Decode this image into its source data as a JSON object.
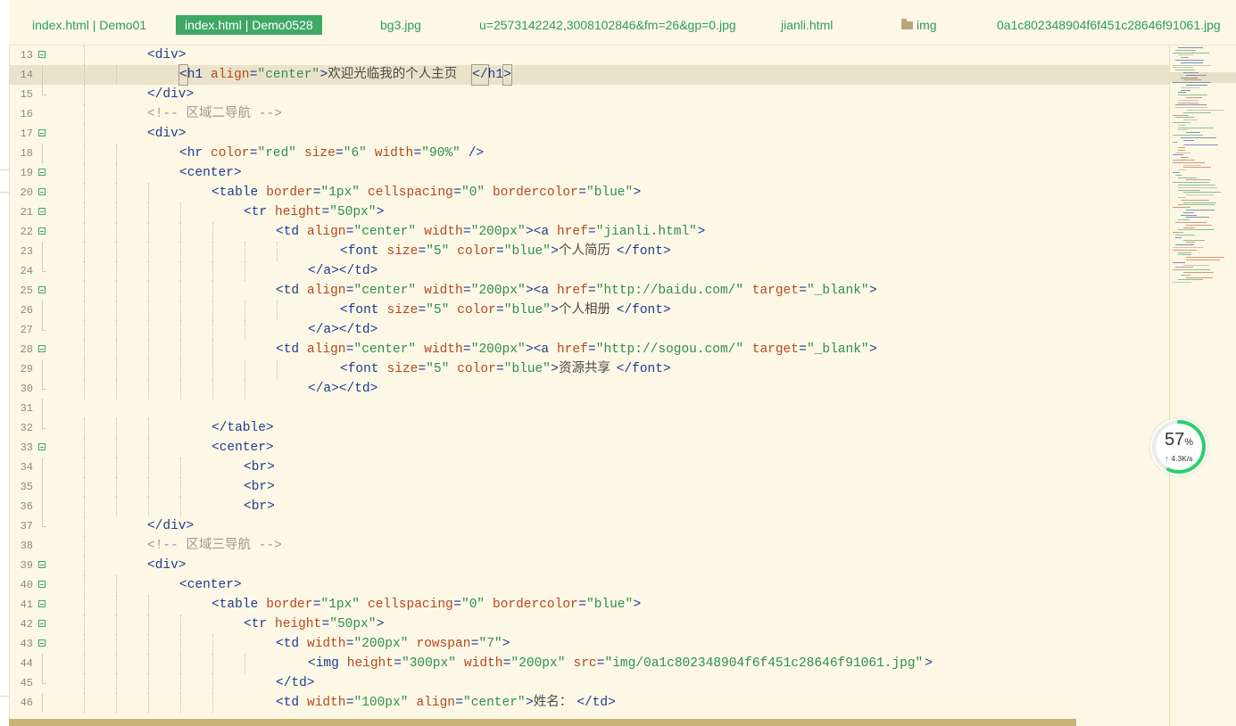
{
  "tabs": [
    {
      "label": "index.html | Demo01",
      "active": false,
      "folder": false
    },
    {
      "label": "index.html | Demo0528",
      "active": true,
      "folder": false
    },
    {
      "label": "bg3.jpg",
      "active": false,
      "folder": false
    },
    {
      "label": "u=2573142242,3008102846&fm=26&gp=0.jpg",
      "active": false,
      "folder": false
    },
    {
      "label": "jianli.html",
      "active": false,
      "folder": false
    },
    {
      "label": "img",
      "active": false,
      "folder": true
    },
    {
      "label": "0a1c802348904f6f451c28646f91061.jpg",
      "active": false,
      "folder": false
    }
  ],
  "editor": {
    "current_line": 14,
    "lines": [
      {
        "n": "13",
        "fold": "start",
        "indent": 2,
        "tokens": [
          [
            "tag",
            "<div>"
          ]
        ]
      },
      {
        "n": "14",
        "fold": "line",
        "indent": 3,
        "tokens": [
          [
            "boxtag",
            "<"
          ],
          [
            "tag",
            "h1 "
          ],
          [
            "attr",
            "align"
          ],
          [
            "tag",
            "="
          ],
          [
            "val",
            "\"center\""
          ],
          [
            "tag",
            ">"
          ],
          [
            "txt",
            "欢迎光临我的个人主页"
          ],
          [
            "boxtag",
            "</"
          ],
          [
            "tag",
            "h1"
          ],
          [
            "boxtag",
            ">"
          ]
        ]
      },
      {
        "n": "15",
        "fold": "end",
        "indent": 2,
        "tokens": [
          [
            "tag",
            "</div>"
          ]
        ]
      },
      {
        "n": "16",
        "fold": "none",
        "indent": 2,
        "tokens": [
          [
            "com",
            "<!-- 区域二导航 -->"
          ]
        ]
      },
      {
        "n": "17",
        "fold": "start",
        "indent": 2,
        "tokens": [
          [
            "tag",
            "<div>"
          ]
        ]
      },
      {
        "n": "18",
        "fold": "line",
        "indent": 3,
        "tokens": [
          [
            "tag",
            "<hr "
          ],
          [
            "attr",
            "color"
          ],
          [
            "tag",
            "="
          ],
          [
            "val",
            "\"red\""
          ],
          [
            "tag",
            " "
          ],
          [
            "attr",
            "size"
          ],
          [
            "tag",
            "="
          ],
          [
            "val",
            "\"6\""
          ],
          [
            "tag",
            " "
          ],
          [
            "attr",
            "width"
          ],
          [
            "tag",
            "="
          ],
          [
            "val",
            "\"90%\""
          ],
          [
            "tag",
            " />"
          ]
        ]
      },
      {
        "n": "19",
        "fold": "start",
        "indent": 3,
        "tokens": [
          [
            "tag",
            "<center>"
          ]
        ]
      },
      {
        "n": "20",
        "fold": "start",
        "indent": 4,
        "tokens": [
          [
            "tag",
            "<table "
          ],
          [
            "attr",
            "border"
          ],
          [
            "tag",
            "="
          ],
          [
            "val",
            "\"1px\""
          ],
          [
            "tag",
            " "
          ],
          [
            "attr",
            "cellspacing"
          ],
          [
            "tag",
            "="
          ],
          [
            "val",
            "\"0\""
          ],
          [
            "tag",
            " "
          ],
          [
            "attr",
            "bordercolor"
          ],
          [
            "tag",
            "="
          ],
          [
            "val",
            "\"blue\""
          ],
          [
            "tag",
            ">"
          ]
        ]
      },
      {
        "n": "21",
        "fold": "start",
        "indent": 5,
        "tokens": [
          [
            "tag",
            "<tr "
          ],
          [
            "attr",
            "height"
          ],
          [
            "tag",
            "="
          ],
          [
            "val",
            "\"50px\""
          ],
          [
            "tag",
            ">"
          ]
        ]
      },
      {
        "n": "22",
        "fold": "start",
        "indent": 6,
        "tokens": [
          [
            "tag",
            "<td "
          ],
          [
            "attr",
            "align"
          ],
          [
            "tag",
            "="
          ],
          [
            "val",
            "\"center\""
          ],
          [
            "tag",
            " "
          ],
          [
            "attr",
            "width"
          ],
          [
            "tag",
            "="
          ],
          [
            "val",
            "\"200px\""
          ],
          [
            "tag",
            "><a "
          ],
          [
            "attr",
            "href"
          ],
          [
            "tag",
            "="
          ],
          [
            "val",
            "\"jianli.html\""
          ],
          [
            "tag",
            ">"
          ]
        ]
      },
      {
        "n": "23",
        "fold": "line",
        "indent": 8,
        "tokens": [
          [
            "tag",
            "<font "
          ],
          [
            "attr",
            "size"
          ],
          [
            "tag",
            "="
          ],
          [
            "val",
            "\"5\""
          ],
          [
            "tag",
            " "
          ],
          [
            "attr",
            "color"
          ],
          [
            "tag",
            "="
          ],
          [
            "val",
            "\"blue\""
          ],
          [
            "tag",
            ">"
          ],
          [
            "txt",
            "个人简历"
          ],
          [
            "tag",
            "</font>"
          ]
        ]
      },
      {
        "n": "24",
        "fold": "end",
        "indent": 7,
        "tokens": [
          [
            "tag",
            "</a></td>"
          ]
        ]
      },
      {
        "n": "25",
        "fold": "start",
        "indent": 6,
        "tokens": [
          [
            "tag",
            "<td "
          ],
          [
            "attr",
            "align"
          ],
          [
            "tag",
            "="
          ],
          [
            "val",
            "\"center\""
          ],
          [
            "tag",
            " "
          ],
          [
            "attr",
            "width"
          ],
          [
            "tag",
            "="
          ],
          [
            "val",
            "\"200px\""
          ],
          [
            "tag",
            "><a "
          ],
          [
            "attr",
            "href"
          ],
          [
            "tag",
            "="
          ],
          [
            "val",
            "\"http://baidu.com/\""
          ],
          [
            "tag",
            " "
          ],
          [
            "attr",
            "target"
          ],
          [
            "tag",
            "="
          ],
          [
            "val",
            "\"_blank\""
          ],
          [
            "tag",
            ">"
          ]
        ]
      },
      {
        "n": "26",
        "fold": "line",
        "indent": 8,
        "tokens": [
          [
            "tag",
            "<font "
          ],
          [
            "attr",
            "size"
          ],
          [
            "tag",
            "="
          ],
          [
            "val",
            "\"5\""
          ],
          [
            "tag",
            " "
          ],
          [
            "attr",
            "color"
          ],
          [
            "tag",
            "="
          ],
          [
            "val",
            "\"blue\""
          ],
          [
            "tag",
            ">"
          ],
          [
            "txt",
            "个人相册"
          ],
          [
            "tag",
            "</font>"
          ]
        ]
      },
      {
        "n": "27",
        "fold": "end",
        "indent": 7,
        "tokens": [
          [
            "tag",
            "</a></td>"
          ]
        ]
      },
      {
        "n": "28",
        "fold": "start",
        "indent": 6,
        "tokens": [
          [
            "tag",
            "<td "
          ],
          [
            "attr",
            "align"
          ],
          [
            "tag",
            "="
          ],
          [
            "val",
            "\"center\""
          ],
          [
            "tag",
            " "
          ],
          [
            "attr",
            "width"
          ],
          [
            "tag",
            "="
          ],
          [
            "val",
            "\"200px\""
          ],
          [
            "tag",
            "><a "
          ],
          [
            "attr",
            "href"
          ],
          [
            "tag",
            "="
          ],
          [
            "val",
            "\"http://sogou.com/\""
          ],
          [
            "tag",
            " "
          ],
          [
            "attr",
            "target"
          ],
          [
            "tag",
            "="
          ],
          [
            "val",
            "\"_blank\""
          ],
          [
            "tag",
            ">"
          ]
        ]
      },
      {
        "n": "29",
        "fold": "line",
        "indent": 8,
        "tokens": [
          [
            "tag",
            "<font "
          ],
          [
            "attr",
            "size"
          ],
          [
            "tag",
            "="
          ],
          [
            "val",
            "\"5\""
          ],
          [
            "tag",
            " "
          ],
          [
            "attr",
            "color"
          ],
          [
            "tag",
            "="
          ],
          [
            "val",
            "\"blue\""
          ],
          [
            "tag",
            ">"
          ],
          [
            "txt",
            "资源共享"
          ],
          [
            "tag",
            "</font>"
          ]
        ]
      },
      {
        "n": "30",
        "fold": "end",
        "indent": 7,
        "tokens": [
          [
            "tag",
            "</a></td>"
          ]
        ]
      },
      {
        "n": "31",
        "fold": "line",
        "indent": 0,
        "tokens": []
      },
      {
        "n": "32",
        "fold": "end",
        "indent": 4,
        "tokens": [
          [
            "tag",
            "</table>"
          ]
        ]
      },
      {
        "n": "33",
        "fold": "start",
        "indent": 4,
        "tokens": [
          [
            "tag",
            "<center>"
          ]
        ]
      },
      {
        "n": "34",
        "fold": "line",
        "indent": 5,
        "tokens": [
          [
            "tag",
            "<br>"
          ]
        ]
      },
      {
        "n": "35",
        "fold": "line",
        "indent": 5,
        "tokens": [
          [
            "tag",
            "<br>"
          ]
        ]
      },
      {
        "n": "36",
        "fold": "line",
        "indent": 5,
        "tokens": [
          [
            "tag",
            "<br>"
          ]
        ]
      },
      {
        "n": "37",
        "fold": "end",
        "indent": 2,
        "tokens": [
          [
            "tag",
            "</div>"
          ]
        ]
      },
      {
        "n": "38",
        "fold": "none",
        "indent": 2,
        "tokens": [
          [
            "com",
            "<!-- 区域三导航 -->"
          ]
        ]
      },
      {
        "n": "39",
        "fold": "start",
        "indent": 2,
        "tokens": [
          [
            "tag",
            "<div>"
          ]
        ]
      },
      {
        "n": "40",
        "fold": "start",
        "indent": 3,
        "tokens": [
          [
            "tag",
            "<center>"
          ]
        ]
      },
      {
        "n": "41",
        "fold": "start",
        "indent": 4,
        "tokens": [
          [
            "tag",
            "<table "
          ],
          [
            "attr",
            "border"
          ],
          [
            "tag",
            "="
          ],
          [
            "val",
            "\"1px\""
          ],
          [
            "tag",
            " "
          ],
          [
            "attr",
            "cellspacing"
          ],
          [
            "tag",
            "="
          ],
          [
            "val",
            "\"0\""
          ],
          [
            "tag",
            " "
          ],
          [
            "attr",
            "bordercolor"
          ],
          [
            "tag",
            "="
          ],
          [
            "val",
            "\"blue\""
          ],
          [
            "tag",
            ">"
          ]
        ]
      },
      {
        "n": "42",
        "fold": "start",
        "indent": 5,
        "tokens": [
          [
            "tag",
            "<tr "
          ],
          [
            "attr",
            "height"
          ],
          [
            "tag",
            "="
          ],
          [
            "val",
            "\"50px\""
          ],
          [
            "tag",
            ">"
          ]
        ]
      },
      {
        "n": "43",
        "fold": "start",
        "indent": 6,
        "tokens": [
          [
            "tag",
            "<td "
          ],
          [
            "attr",
            "width"
          ],
          [
            "tag",
            "="
          ],
          [
            "val",
            "\"200px\""
          ],
          [
            "tag",
            " "
          ],
          [
            "attr",
            "rowspan"
          ],
          [
            "tag",
            "="
          ],
          [
            "val",
            "\"7\""
          ],
          [
            "tag",
            ">"
          ]
        ]
      },
      {
        "n": "44",
        "fold": "line",
        "indent": 7,
        "tokens": [
          [
            "tag",
            "<img "
          ],
          [
            "attr",
            "height"
          ],
          [
            "tag",
            "="
          ],
          [
            "val",
            "\"300px\""
          ],
          [
            "tag",
            " "
          ],
          [
            "attr",
            "width"
          ],
          [
            "tag",
            "="
          ],
          [
            "val",
            "\"200px\""
          ],
          [
            "tag",
            " "
          ],
          [
            "attr",
            "src"
          ],
          [
            "tag",
            "="
          ],
          [
            "val",
            "\"img/0a1c802348904f6f451c28646f91061.jpg\""
          ],
          [
            "tag",
            ">"
          ]
        ]
      },
      {
        "n": "45",
        "fold": "end",
        "indent": 6,
        "tokens": [
          [
            "tag",
            "</td>"
          ]
        ]
      },
      {
        "n": "46",
        "fold": "line",
        "indent": 6,
        "tokens": [
          [
            "tag",
            "<td "
          ],
          [
            "attr",
            "width"
          ],
          [
            "tag",
            "="
          ],
          [
            "val",
            "\"100px\""
          ],
          [
            "tag",
            " "
          ],
          [
            "attr",
            "align"
          ],
          [
            "tag",
            "="
          ],
          [
            "val",
            "\"center\""
          ],
          [
            "tag",
            ">"
          ],
          [
            "txt",
            "姓名："
          ],
          [
            "tag",
            "</td>"
          ]
        ]
      }
    ]
  },
  "speed_widget": {
    "percent": "57",
    "percent_unit": "%",
    "percent_value": 57,
    "rate": "4.3K/s",
    "arrow_icon": "up-arrow-icon",
    "ring_color": "#2bd16a"
  },
  "colors": {
    "tag": "#1e3a8f",
    "attr": "#b5471e",
    "value": "#2e8f4a",
    "comment": "#9c9a8e",
    "active_tab": "#3fa865"
  }
}
